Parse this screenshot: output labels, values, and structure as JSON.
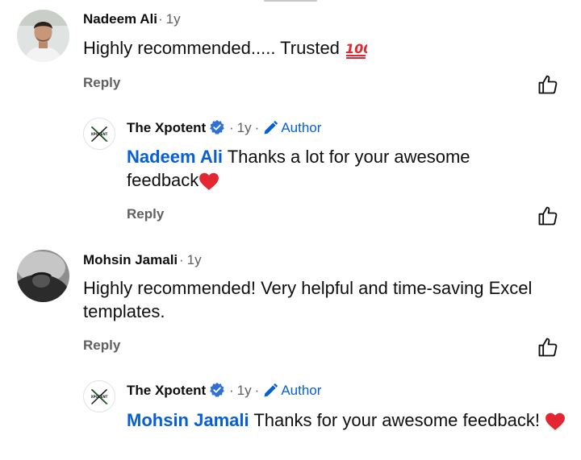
{
  "comments": [
    {
      "author": "Nadeem Ali",
      "age": "1y",
      "text": "Highly recommended.....  Trusted",
      "emoji": "hundred-points",
      "reply_label": "Reply",
      "reply": {
        "author": "The Xpotent",
        "age": "1y",
        "badge": "Author",
        "mention": "Nadeem Ali",
        "text": "Thanks a lot for your awesome feedback",
        "emoji": "red-heart",
        "reply_label": "Reply"
      }
    },
    {
      "author": "Mohsin Jamali",
      "age": "1y",
      "text": "Highly recommended! Very helpful and time-saving Excel templates.",
      "reply_label": "Reply",
      "reply": {
        "author": "The Xpotent",
        "age": "1y",
        "badge": "Author",
        "mention": "Mohsin Jamali",
        "text": "Thanks for your awesome feedback!",
        "emoji": "red-heart"
      }
    }
  ],
  "channel_logo_text": "XPOTENT",
  "colors": {
    "link": "#065fd4",
    "meta": "#606060",
    "heart": "#e3262f",
    "hundred": "#e3262f"
  }
}
